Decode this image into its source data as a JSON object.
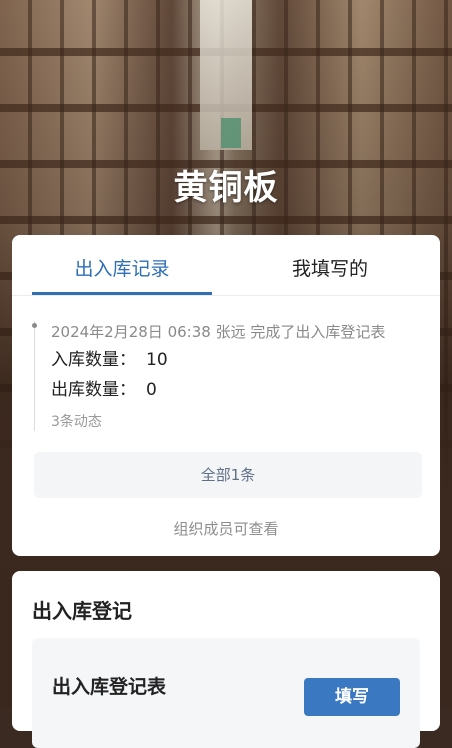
{
  "header": {
    "title": "黄铜板"
  },
  "tabs": [
    {
      "label": "出入库记录",
      "active": true
    },
    {
      "label": "我填写的",
      "active": false
    }
  ],
  "timeline": {
    "entry": {
      "text": "2024年2月28日 06:38  张远  完成了出入库登记表",
      "in_label": "入库数量：",
      "in_value": "10",
      "out_label": "出库数量：",
      "out_value": "0"
    },
    "count_text": "3条动态"
  },
  "all_button_label": "全部1条",
  "visibility_note": "组织成员可查看",
  "register_section": {
    "title": "出入库登记",
    "form_name": "出入库登记表",
    "fill_label": "填写"
  },
  "colors": {
    "accent": "#2f6fb5",
    "button_primary": "#3a78c2",
    "muted_text": "#8a8a8a"
  }
}
